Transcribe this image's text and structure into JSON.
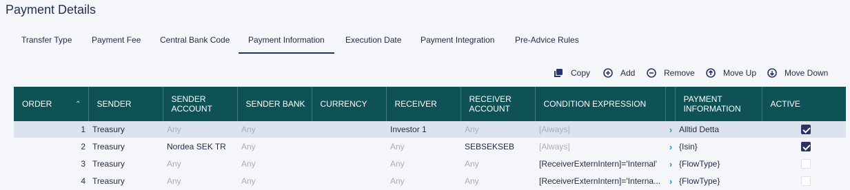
{
  "page": {
    "title": "Payment Details"
  },
  "tabs": [
    {
      "label": "Transfer Type"
    },
    {
      "label": "Payment Fee"
    },
    {
      "label": "Central Bank Code"
    },
    {
      "label": "Payment Information"
    },
    {
      "label": "Execution Date"
    },
    {
      "label": "Payment Integration"
    },
    {
      "label": "Pre-Advice Rules"
    }
  ],
  "active_tab": "Payment Information",
  "toolbar": {
    "copy": "Copy",
    "add": "Add",
    "remove": "Remove",
    "move_up": "Move Up",
    "move_down": "Move Down"
  },
  "grid": {
    "columns": {
      "order": "ORDER",
      "sender": "SENDER",
      "sender_account": "SENDER ACCOUNT",
      "sender_bank": "SENDER BANK",
      "currency": "CURRENCY",
      "receiver": "RECEIVER",
      "receiver_account": "RECEIVER ACCOUNT",
      "condition": "CONDITION EXPRESSION",
      "payment_info": "PAYMENT INFORMATION",
      "active": "ACTIVE"
    },
    "rows": [
      {
        "order": "1",
        "sender": "Treasury",
        "sender_account": "Any",
        "sender_bank": "Any",
        "currency": "",
        "receiver": "Investor 1",
        "receiver_account": "Any",
        "condition": "[Always]",
        "payment_info": "Alltid Detta",
        "active": true
      },
      {
        "order": "2",
        "sender": "Treasury",
        "sender_account": "Nordea SEK TR",
        "sender_bank": "Any",
        "currency": "",
        "receiver": "Any",
        "receiver_account": "SEBSEKSEB",
        "condition": "[Always]",
        "payment_info": "{Isin}",
        "active": true
      },
      {
        "order": "3",
        "sender": "Treasury",
        "sender_account": "Any",
        "sender_bank": "Any",
        "currency": "",
        "receiver": "Any",
        "receiver_account": "Any",
        "condition": "[ReceiverExternIntern]='Internal'",
        "payment_info": "{FlowType}",
        "active": false
      },
      {
        "order": "4",
        "sender": "Treasury",
        "sender_account": "Any",
        "sender_bank": "Any",
        "currency": "",
        "receiver": "Any",
        "receiver_account": "Any",
        "condition": "[ReceiverExternIntern]='Interna...",
        "payment_info": "{FlowType}",
        "active": false
      }
    ]
  }
}
